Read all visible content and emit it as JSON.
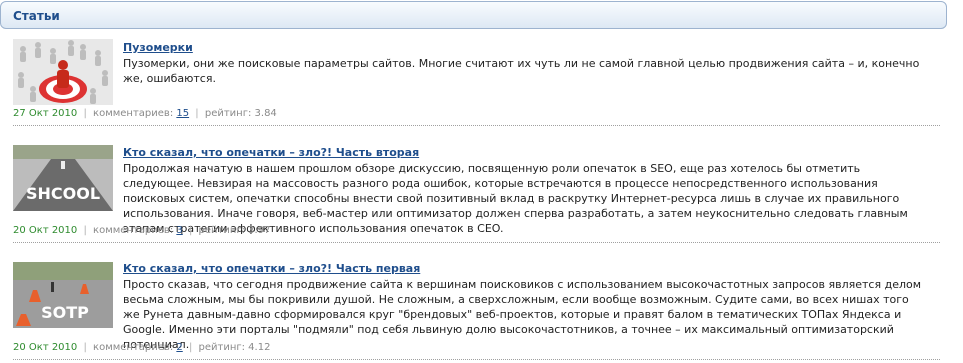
{
  "panel": {
    "title": "Статьи"
  },
  "articles": [
    {
      "title": "Пузомерки",
      "body": "Пузомерки, они же поисковые параметры сайтов. Многие считают их чуть ли не самой главной целью продвижения сайта – и, конечно же, ошибаются.",
      "date": "27 Окт 2010",
      "comments_label": "комментариев:",
      "comments_count": "15",
      "rating_label": "рейтинг:",
      "rating_value": "3.84"
    },
    {
      "title": "Кто сказал, что опечатки – зло?! Часть вторая",
      "body": "Продолжая начатую в нашем прошлом обзоре дискуссию, посвященную роли опечаток в SEO, еще раз хотелось бы отметить следующее. Невзирая на массовость разного рода ошибок, которые встречаются в процессе непосредственного использования поисковых систем, опечатки способны внести свой позитивный вклад в раскрутку Интернет-ресурса лишь в случае их правильного использования. Иначе говоря, веб-мастер или оптимизатор должен сперва разработать, а затем неукоснительно следовать главным этапам стратегии эффективного использования опечаток в CEO.",
      "date": "20 Окт 2010",
      "comments_label": "комментариев:",
      "comments_count": "3",
      "rating_label": "рейтинг:",
      "rating_value": "3.97",
      "image_text": "SHCOOL"
    },
    {
      "title": "Кто сказал, что опечатки – зло?! Часть первая",
      "body": "Просто сказав, что сегодня продвижение сайта к вершинам поисковиков с использованием высокочастотных запросов является делом весьма сложным, мы бы покривили душой. Не сложным, а сверхсложным, если вообще возможным. Судите сами, во всех нишах того же Рунета давным-давно сформировался круг \"брендовых\" веб-проектов, которые и правят балом в тематических ТОПах Яндекса и Google. Именно эти порталы \"подмяли\" под себя львиную долю высокочастотников, а точнее – их максимальный оптимизаторский потенциал.",
      "date": "20 Окт 2010",
      "comments_label": "комментариев:",
      "comments_count": "2",
      "rating_label": "рейтинг:",
      "rating_value": "4.12",
      "image_text": "SOTP"
    }
  ]
}
